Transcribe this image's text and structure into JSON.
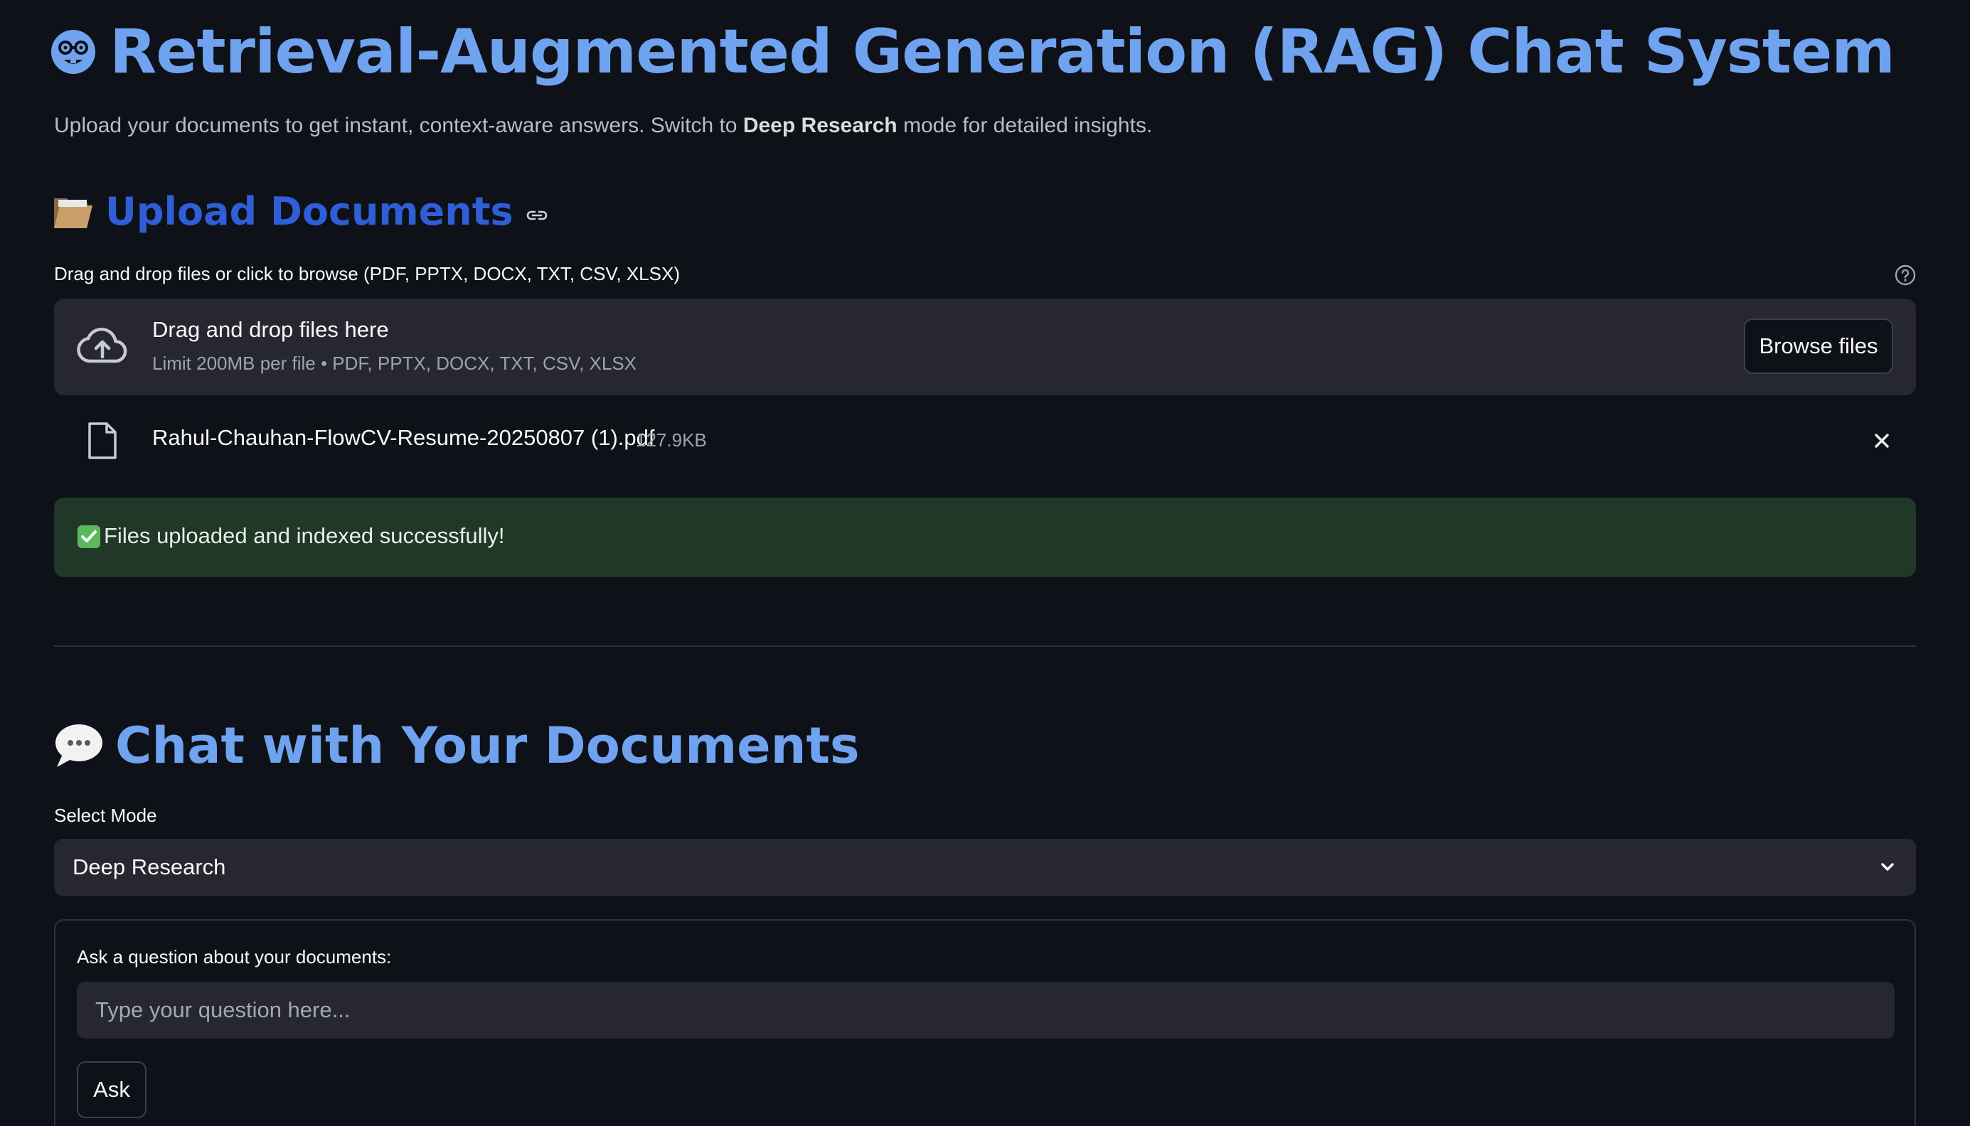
{
  "header": {
    "title": "Retrieval-Augmented Generation (RAG) Chat System",
    "title_icon": "nerd-face-emoji",
    "subtitle_prefix": "Upload your documents to get instant, context-aware answers. Switch to ",
    "subtitle_bold": "Deep Research",
    "subtitle_suffix": " mode for detailed insights."
  },
  "upload": {
    "section_icon": "folder-emoji",
    "section_title": "Upload Documents",
    "anchor_icon": "link-icon",
    "uploader_label": "Drag and drop files or click to browse (PDF, PPTX, DOCX, TXT, CSV, XLSX)",
    "help_icon": "help-circle-icon",
    "dropzone_title": "Drag and drop files here",
    "dropzone_subtitle": "Limit 200MB per file • PDF, PPTX, DOCX, TXT, CSV, XLSX",
    "browse_label": "Browse files",
    "files": [
      {
        "name": "Rahul-Chauhan-FlowCV-Resume-20250807 (1).pdf",
        "size": "127.9KB"
      }
    ],
    "success_message": "Files uploaded and indexed successfully!"
  },
  "chat": {
    "section_icon": "speech-bubble-emoji",
    "section_title": "Chat with Your Documents",
    "mode_label": "Select Mode",
    "mode_selected": "Deep Research",
    "question_label": "Ask a question about your documents:",
    "question_placeholder": "Type your question here...",
    "ask_label": "Ask"
  },
  "colors": {
    "background": "#0e1117",
    "title_blue": "#6fa3f0",
    "section_blue": "#2f5ed6",
    "panel": "#262730",
    "success_bg": "#213728"
  }
}
